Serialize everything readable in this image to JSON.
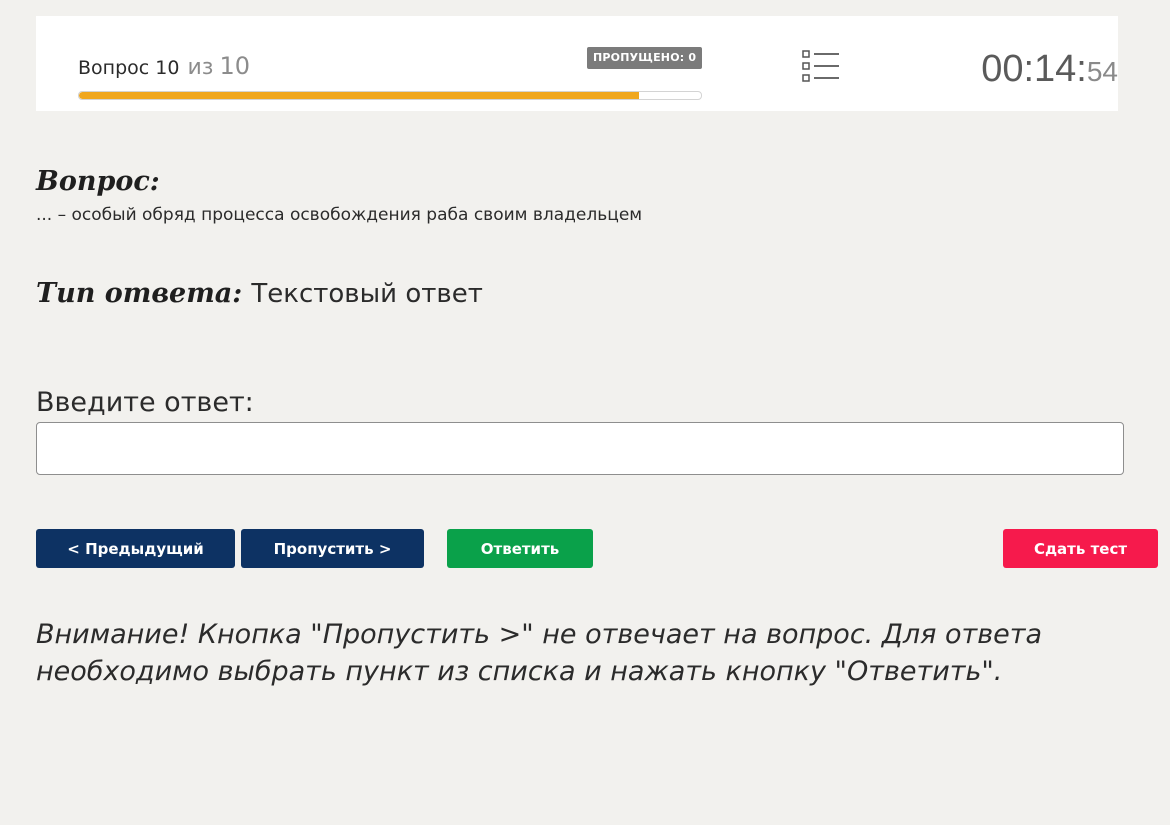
{
  "header": {
    "question_label": "Вопрос 10",
    "of_label": "из",
    "total": "10",
    "skipped_badge": "ПРОПУЩЕНО: 0",
    "progress": 0.9,
    "timer_hm": "00:14:",
    "timer_s": "54",
    "progress_color": "#f0a71e"
  },
  "question": {
    "heading": "Вопрос:",
    "text": "... – особый обряд процесса освобождения раба своим владельцем",
    "type_label": "Тип ответа:",
    "type_value": "Текстовый ответ"
  },
  "answer": {
    "label": "Введите ответ:",
    "value": ""
  },
  "buttons": {
    "prev": "< Предыдущий",
    "skip": "Пропустить >",
    "answer": "Ответить",
    "submit": "Сдать тест"
  },
  "colors": {
    "navy": "#0d3263",
    "green": "#0aa14a",
    "red": "#f61a4c"
  },
  "notice": "Внимание! Кнопка \"Пропустить >\" не отвечает на вопрос. Для ответа необходимо выбрать пункт из списка и нажать кнопку \"Ответить\".",
  "icons": {
    "question_list": "list-icon"
  }
}
